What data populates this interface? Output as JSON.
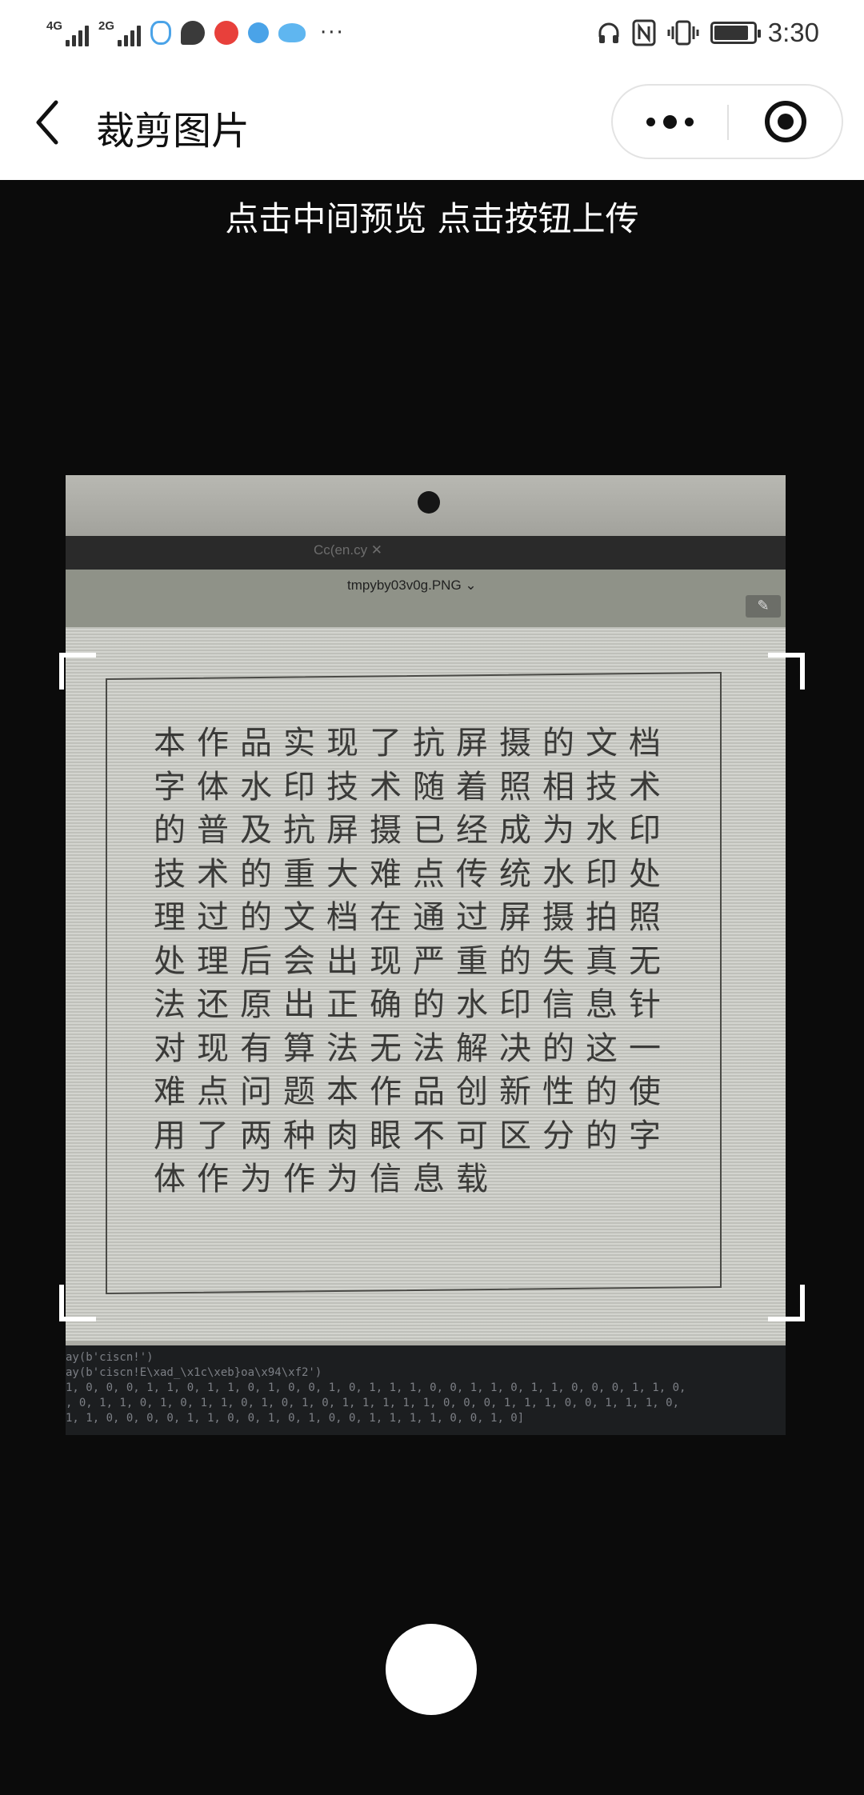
{
  "status_bar": {
    "network_1": "4G",
    "network_2": "2G",
    "more": "···",
    "time": "3:30"
  },
  "nav": {
    "title": "裁剪图片"
  },
  "hint": "点击中间预览 点击按钮上传",
  "photo": {
    "tab_label": "Cc(en.cy  ✕",
    "file_name": "tmpyby03v0g.PNG ⌄",
    "document_text": "本作品实现了抗屏摄的文档字体水印技术随着照相技术的普及抗屏摄已经成为水印技术的重大难点传统水印处理过的文档在通过屏摄拍照处理后会出现严重的失真无法还原出正确的水印信息针对现有算法无法解决的这一难点问题本作品创新性的使用了两种肉眼不可区分的字体作为作为信息载",
    "terminal_lines": [
      "ay(b'ciscn!')",
      "ay(b'ciscn!E\\xad_\\x1c\\xeb}oa\\x94\\xf2')",
      "1, 0, 0, 0, 1, 1, 0, 1, 1, 0, 1, 0, 0, 1, 0, 1, 1, 1, 0, 0, 1, 1, 0, 1, 1, 0, 0, 0, 1, 1, 0,",
      ", 0, 1, 1, 0, 1, 0, 1, 1, 0, 1, 0, 1, 0, 1, 1, 1, 1, 1, 0, 0, 0, 1, 1, 1, 0, 0, 1, 1, 1, 0,",
      " 1, 1, 0, 0, 0, 0, 1, 1, 0, 0, 1, 0, 1, 0, 0, 1, 1, 1, 1, 0, 0, 1, 0]"
    ]
  },
  "colors": {
    "background": "#0b0b0b",
    "bar": "#ffffff",
    "accent_red": "#e8403b",
    "accent_blue": "#4aa3e8"
  }
}
